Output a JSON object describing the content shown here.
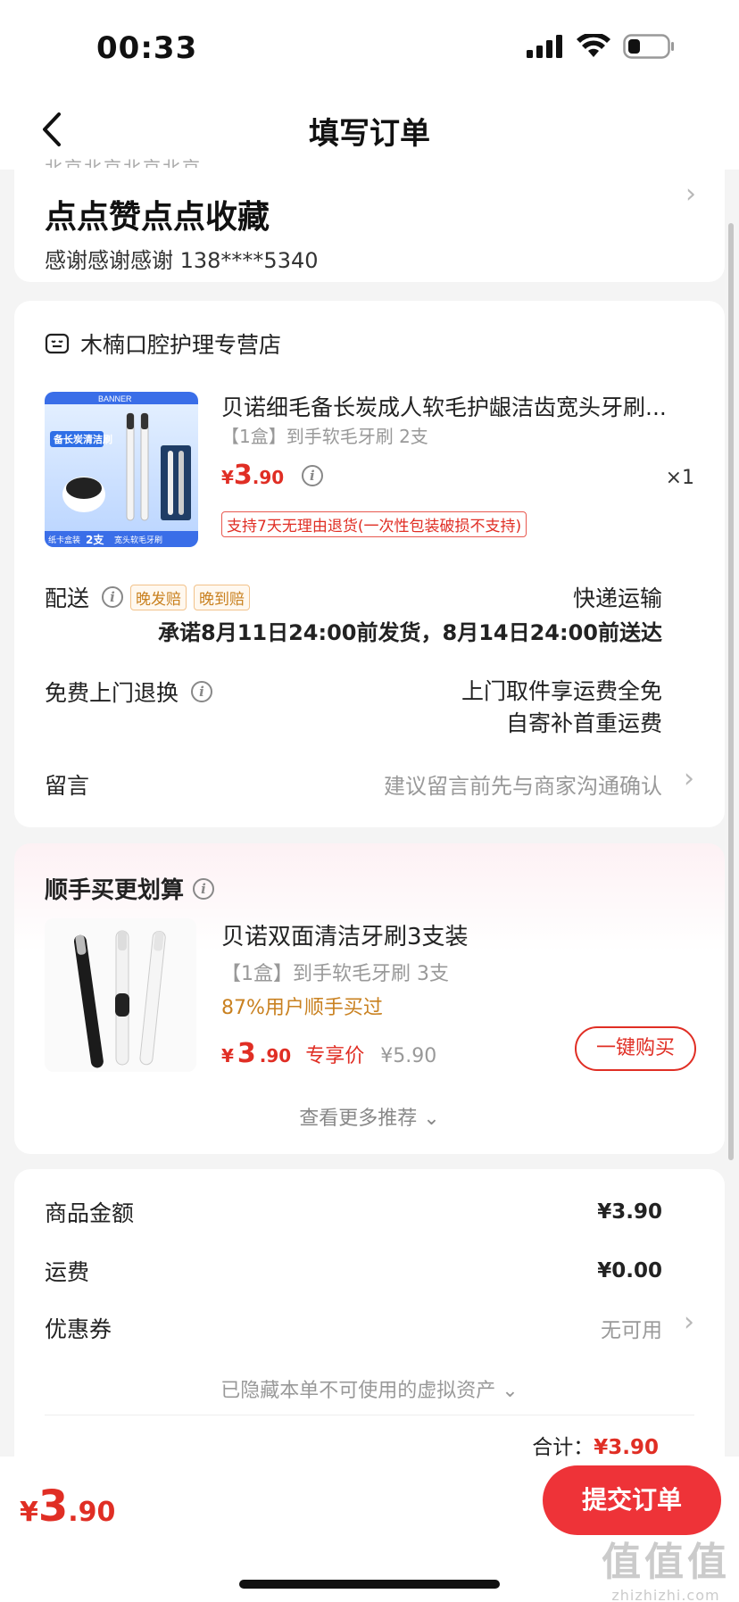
{
  "status_bar": {
    "time": "00:33"
  },
  "nav": {
    "title": "填写订单"
  },
  "address": {
    "ghost_text": "北京北京北京北京",
    "name": "点点赞点点收藏",
    "contact": "感谢感谢感谢  138****5340"
  },
  "store": {
    "name": "木楠口腔护理专营店",
    "product": {
      "title": "贝诺细毛备长炭成人软毛护龈洁齿宽头牙刷...",
      "spec": "【1盒】到手软毛牙刷 2支",
      "price_currency": "¥",
      "price_int": "3",
      "price_dec": ".90",
      "quantity": "×1",
      "return_policy": "支持7天无理由退货(一次性包装破损不支持)",
      "image_texts": {
        "brand": "BANNER",
        "headline": "备长炭清洁刷",
        "footer_left": "纸卡盒装",
        "footer_count": "2支",
        "footer_right": "宽头软毛牙刷"
      }
    },
    "delivery": {
      "label": "配送",
      "tag1": "晚发赔",
      "tag2": "晚到赔",
      "method": "快递运输",
      "promise": "承诺8月11日24:00前发货，8月14日24:00前送达"
    },
    "return_service": {
      "label": "免费上门退换",
      "line1": "上门取件享运费全免",
      "line2": "自寄补首重运费"
    },
    "message": {
      "label": "留言",
      "placeholder": "建议留言前先与商家沟通确认"
    }
  },
  "recommend": {
    "title": "顺手买更划算",
    "item": {
      "title": "贝诺双面清洁牙刷3支装",
      "spec": "【1盒】到手软毛牙刷 3支",
      "bought": "87%用户顺手买过",
      "price_currency": "¥",
      "price_int": "3",
      "price_dec": ".90",
      "exclusive_label": "专享价",
      "original_price": "¥5.90",
      "buy_label": "一键购买"
    },
    "more_label": "查看更多推荐 ⌄"
  },
  "summary": {
    "goods_label": "商品金额",
    "goods_value": "¥3.90",
    "shipping_label": "运费",
    "shipping_value": "¥0.00",
    "coupon_label": "优惠券",
    "coupon_value": "无可用",
    "hidden_note": "已隐藏本单不可使用的虚拟资产 ⌄",
    "total_label": "合计：",
    "total_value": "¥3.90"
  },
  "bottom": {
    "price_currency": "¥",
    "price_int": "3",
    "price_dec": ".90",
    "submit_label": "提交订单"
  },
  "watermark": {
    "big": "值值值",
    "small": "zhizhizhi.com"
  },
  "colors": {
    "accent": "#e02e24",
    "button": "#ee3338",
    "tag_orange": "#c98120"
  }
}
